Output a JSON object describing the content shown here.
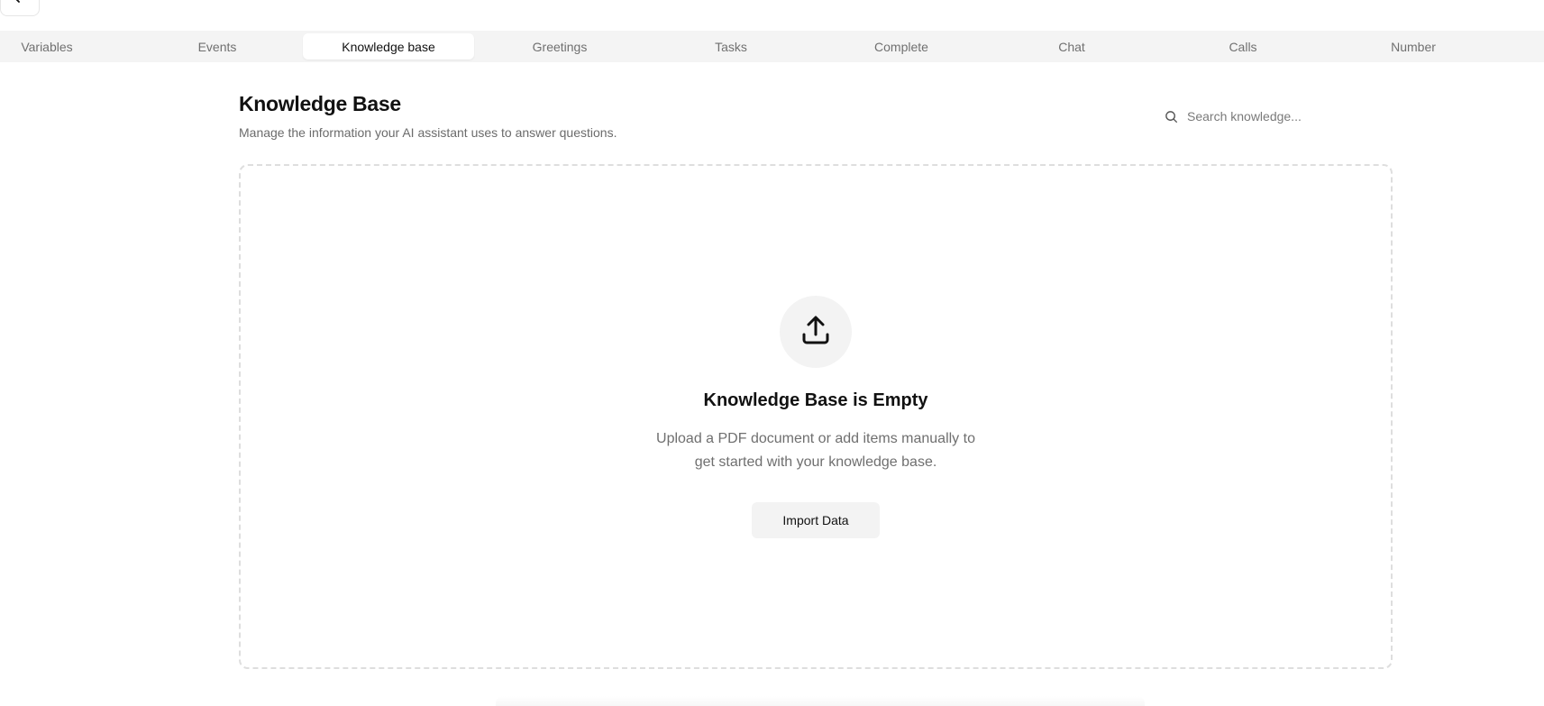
{
  "nav": {
    "back_icon": "arrow-left-icon"
  },
  "tabs": [
    {
      "label": "Variables",
      "active": false
    },
    {
      "label": "Events",
      "active": false
    },
    {
      "label": "Knowledge base",
      "active": true
    },
    {
      "label": "Greetings",
      "active": false
    },
    {
      "label": "Tasks",
      "active": false
    },
    {
      "label": "Complete",
      "active": false
    },
    {
      "label": "Chat",
      "active": false
    },
    {
      "label": "Calls",
      "active": false
    },
    {
      "label": "Number",
      "active": false
    }
  ],
  "header": {
    "title": "Knowledge Base",
    "subtitle": "Manage the information your AI assistant uses to answer questions."
  },
  "search": {
    "placeholder": "Search knowledge...",
    "value": "",
    "icon": "search-icon"
  },
  "empty_state": {
    "icon": "upload-icon",
    "title": "Knowledge Base is Empty",
    "description_line1": "Upload a PDF document or add items manually to",
    "description_line2": "get started with your knowledge base.",
    "button_label": "Import Data"
  },
  "colors": {
    "tab_bar_bg": "#f4f4f4",
    "tab_active_bg": "#ffffff",
    "muted_text": "#6b6b6b",
    "button_bg": "#f3f3f3",
    "dashed_border": "#dedede"
  }
}
